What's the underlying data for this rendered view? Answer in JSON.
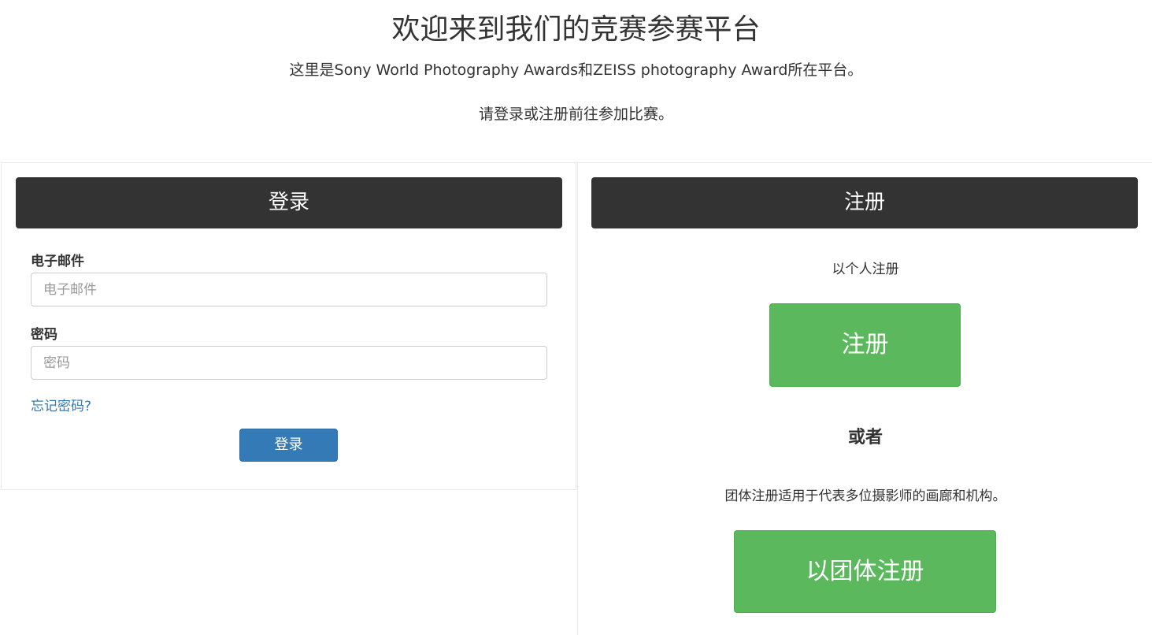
{
  "header": {
    "title": "欢迎来到我们的竞赛参赛平台",
    "subtitle": "这里是Sony World Photography Awards和ZEISS photography Award所在平台。",
    "prompt": "请登录或注册前往参加比赛。"
  },
  "login": {
    "heading": "登录",
    "email_label": "电子邮件",
    "email_placeholder": "电子邮件",
    "password_label": "密码",
    "password_placeholder": "密码",
    "forgot_link": "忘记密码?",
    "submit_label": "登录"
  },
  "register": {
    "heading": "注册",
    "individual_text": "以个人注册",
    "individual_button": "注册",
    "or_text": "或者",
    "group_text": "团体注册适用于代表多位摄影师的画廊和机构。",
    "group_button": "以团体注册"
  },
  "colors": {
    "panel_header_bg": "#333333",
    "primary_button": "#337ab7",
    "success_button": "#5cb85c",
    "link": "#337ab7"
  }
}
